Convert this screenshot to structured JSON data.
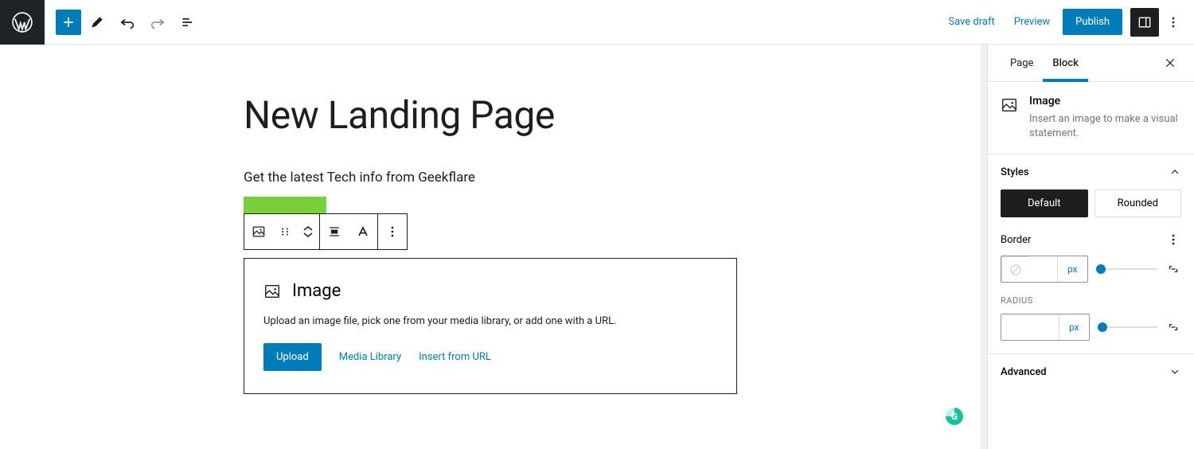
{
  "topbar": {
    "save_draft": "Save draft",
    "preview": "Preview",
    "publish": "Publish"
  },
  "page": {
    "title": "New Landing Page",
    "paragraph": "Get the latest Tech info from Geekflare"
  },
  "image_block": {
    "title": "Image",
    "description": "Upload an image file, pick one from your media library, or add one with a URL.",
    "upload": "Upload",
    "media_library": "Media Library",
    "insert_url": "Insert from URL"
  },
  "sidebar": {
    "tab_page": "Page",
    "tab_block": "Block",
    "block_name": "Image",
    "block_desc": "Insert an image to make a visual statement.",
    "styles_label": "Styles",
    "style_default": "Default",
    "style_rounded": "Rounded",
    "border_label": "Border",
    "unit": "px",
    "radius_label": "RADIUS",
    "advanced_label": "Advanced"
  }
}
